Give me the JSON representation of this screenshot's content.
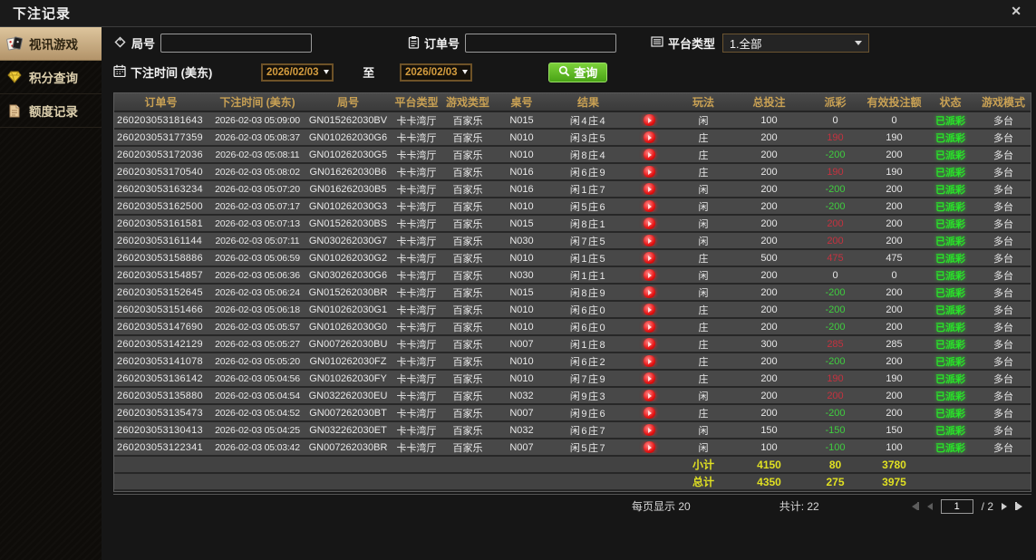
{
  "window": {
    "title": "下注记录",
    "close": "✕"
  },
  "sidebar": {
    "items": [
      {
        "label": "视讯游戏",
        "icon": "cards-icon",
        "active": true
      },
      {
        "label": "积分查询",
        "icon": "gem-icon",
        "active": false
      },
      {
        "label": "额度记录",
        "icon": "document-icon",
        "active": false
      }
    ]
  },
  "filters": {
    "round_no": {
      "label": "局号",
      "value": "",
      "icon": "tag-icon"
    },
    "order_no": {
      "label": "订单号",
      "value": "",
      "icon": "clipboard-icon"
    },
    "platform_type": {
      "label": "平台类型",
      "value": "1.全部",
      "icon": "list-icon"
    },
    "bet_time": {
      "label": "下注时间 (美东)",
      "icon": "calendar-icon",
      "from": "2026/02/03",
      "to_label": "至",
      "to": "2026/02/03"
    },
    "search": {
      "label": "查询",
      "icon": "magnifier-icon"
    }
  },
  "table": {
    "headers": [
      "订单号",
      "下注时间 (美东)",
      "局号",
      "平台类型",
      "游戏类型",
      "桌号",
      "结果",
      "玩法",
      "总投注",
      "派彩",
      "有效投注额",
      "状态",
      "游戏模式"
    ],
    "rows": [
      [
        "260203053181643",
        "2026-02-03 05:09:00",
        "GN015262030BV",
        "卡卡湾厅",
        "百家乐",
        "N015",
        "闲4庄4",
        "闲",
        "100",
        "0",
        "0",
        "已派彩",
        "多台"
      ],
      [
        "260203053177359",
        "2026-02-03 05:08:37",
        "GN010262030G6",
        "卡卡湾厅",
        "百家乐",
        "N010",
        "闲3庄5",
        "庄",
        "200",
        "190",
        "190",
        "已派彩",
        "多台"
      ],
      [
        "260203053172036",
        "2026-02-03 05:08:11",
        "GN010262030G5",
        "卡卡湾厅",
        "百家乐",
        "N010",
        "闲8庄4",
        "庄",
        "200",
        "-200",
        "200",
        "已派彩",
        "多台"
      ],
      [
        "260203053170540",
        "2026-02-03 05:08:02",
        "GN016262030B6",
        "卡卡湾厅",
        "百家乐",
        "N016",
        "闲6庄9",
        "庄",
        "200",
        "190",
        "190",
        "已派彩",
        "多台"
      ],
      [
        "260203053163234",
        "2026-02-03 05:07:20",
        "GN016262030B5",
        "卡卡湾厅",
        "百家乐",
        "N016",
        "闲1庄7",
        "闲",
        "200",
        "-200",
        "200",
        "已派彩",
        "多台"
      ],
      [
        "260203053162500",
        "2026-02-03 05:07:17",
        "GN010262030G3",
        "卡卡湾厅",
        "百家乐",
        "N010",
        "闲5庄6",
        "闲",
        "200",
        "-200",
        "200",
        "已派彩",
        "多台"
      ],
      [
        "260203053161581",
        "2026-02-03 05:07:13",
        "GN015262030BS",
        "卡卡湾厅",
        "百家乐",
        "N015",
        "闲8庄1",
        "闲",
        "200",
        "200",
        "200",
        "已派彩",
        "多台"
      ],
      [
        "260203053161144",
        "2026-02-03 05:07:11",
        "GN030262030G7",
        "卡卡湾厅",
        "百家乐",
        "N030",
        "闲7庄5",
        "闲",
        "200",
        "200",
        "200",
        "已派彩",
        "多台"
      ],
      [
        "260203053158886",
        "2026-02-03 05:06:59",
        "GN010262030G2",
        "卡卡湾厅",
        "百家乐",
        "N010",
        "闲1庄5",
        "庄",
        "500",
        "475",
        "475",
        "已派彩",
        "多台"
      ],
      [
        "260203053154857",
        "2026-02-03 05:06:36",
        "GN030262030G6",
        "卡卡湾厅",
        "百家乐",
        "N030",
        "闲1庄1",
        "闲",
        "200",
        "0",
        "0",
        "已派彩",
        "多台"
      ],
      [
        "260203053152645",
        "2026-02-03 05:06:24",
        "GN015262030BR",
        "卡卡湾厅",
        "百家乐",
        "N015",
        "闲8庄9",
        "闲",
        "200",
        "-200",
        "200",
        "已派彩",
        "多台"
      ],
      [
        "260203053151466",
        "2026-02-03 05:06:18",
        "GN010262030G1",
        "卡卡湾厅",
        "百家乐",
        "N010",
        "闲6庄0",
        "庄",
        "200",
        "-200",
        "200",
        "已派彩",
        "多台"
      ],
      [
        "260203053147690",
        "2026-02-03 05:05:57",
        "GN010262030G0",
        "卡卡湾厅",
        "百家乐",
        "N010",
        "闲6庄0",
        "庄",
        "200",
        "-200",
        "200",
        "已派彩",
        "多台"
      ],
      [
        "260203053142129",
        "2026-02-03 05:05:27",
        "GN007262030BU",
        "卡卡湾厅",
        "百家乐",
        "N007",
        "闲1庄8",
        "庄",
        "300",
        "285",
        "285",
        "已派彩",
        "多台"
      ],
      [
        "260203053141078",
        "2026-02-03 05:05:20",
        "GN010262030FZ",
        "卡卡湾厅",
        "百家乐",
        "N010",
        "闲6庄2",
        "庄",
        "200",
        "-200",
        "200",
        "已派彩",
        "多台"
      ],
      [
        "260203053136142",
        "2026-02-03 05:04:56",
        "GN010262030FY",
        "卡卡湾厅",
        "百家乐",
        "N010",
        "闲7庄9",
        "庄",
        "200",
        "190",
        "190",
        "已派彩",
        "多台"
      ],
      [
        "260203053135880",
        "2026-02-03 05:04:54",
        "GN032262030EU",
        "卡卡湾厅",
        "百家乐",
        "N032",
        "闲9庄3",
        "闲",
        "200",
        "200",
        "200",
        "已派彩",
        "多台"
      ],
      [
        "260203053135473",
        "2026-02-03 05:04:52",
        "GN007262030BT",
        "卡卡湾厅",
        "百家乐",
        "N007",
        "闲9庄6",
        "庄",
        "200",
        "-200",
        "200",
        "已派彩",
        "多台"
      ],
      [
        "260203053130413",
        "2026-02-03 05:04:25",
        "GN032262030ET",
        "卡卡湾厅",
        "百家乐",
        "N032",
        "闲6庄7",
        "闲",
        "150",
        "-150",
        "150",
        "已派彩",
        "多台"
      ],
      [
        "260203053122341",
        "2026-02-03 05:03:42",
        "GN007262030BR",
        "卡卡湾厅",
        "百家乐",
        "N007",
        "闲5庄7",
        "闲",
        "100",
        "-100",
        "100",
        "已派彩",
        "多台"
      ]
    ],
    "subtotal": {
      "label": "小计",
      "total_bet": "4150",
      "payout": "80",
      "valid_bet": "3780"
    },
    "grand_total": {
      "label": "总计",
      "total_bet": "4350",
      "payout": "275",
      "valid_bet": "3975"
    }
  },
  "pagination": {
    "per_page": "每页显示 20",
    "total_count": "共计: 22",
    "page": "1",
    "page_of": "/ 2"
  },
  "colors": {
    "accent_gold": "#c9a154",
    "payout_win_red": "#c5323f",
    "payout_loss_green": "#3fce3f",
    "status_green": "#29e229",
    "totals_yellow": "#e0e022",
    "button_green": "#5cb82a"
  }
}
